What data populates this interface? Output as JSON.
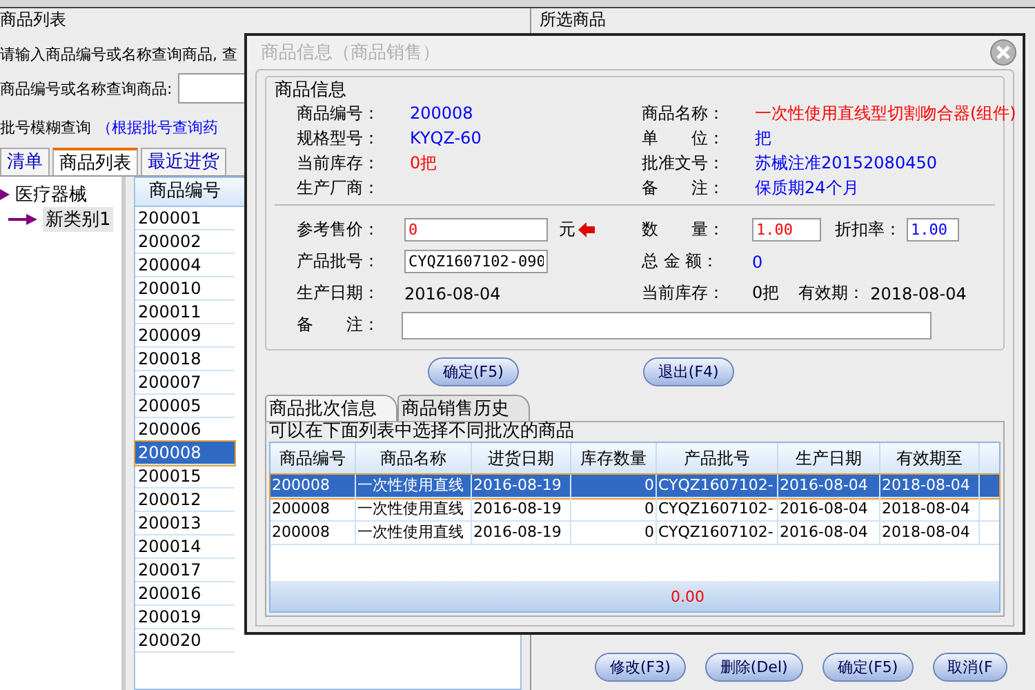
{
  "left_panel": {
    "group_title": "商品列表",
    "hint": "请输入商品编号或名称查询商品, 查",
    "search_label": "商品编号或名称查询商品:",
    "batch_label": "批号模糊查询",
    "batch_hint": "（根据批号查询药",
    "tabs": [
      {
        "label": "清单",
        "selected": false
      },
      {
        "label": "商品列表",
        "selected": true
      },
      {
        "label": "最近进货",
        "selected": false
      }
    ],
    "tree": [
      {
        "label": "医疗器械",
        "children": [
          {
            "label": "新类别1"
          }
        ]
      }
    ],
    "table": {
      "columns": [
        "商品编号"
      ],
      "rows": [
        {
          "code": "200001",
          "selected": false
        },
        {
          "code": "200002",
          "selected": false
        },
        {
          "code": "200004",
          "selected": false
        },
        {
          "code": "200010",
          "selected": false
        },
        {
          "code": "200011",
          "selected": false
        },
        {
          "code": "200009",
          "selected": false
        },
        {
          "code": "200018",
          "selected": false
        },
        {
          "code": "200007",
          "selected": false
        },
        {
          "code": "200005",
          "selected": false
        },
        {
          "code": "200006",
          "selected": false
        },
        {
          "code": "200008",
          "selected": true
        },
        {
          "code": "200015",
          "selected": false
        },
        {
          "code": "200012",
          "selected": false
        },
        {
          "code": "200013",
          "selected": false
        },
        {
          "code": "200014",
          "selected": false
        },
        {
          "code": "200017",
          "selected": false
        },
        {
          "code": "200016",
          "selected": false
        },
        {
          "code": "200019",
          "selected": false
        },
        {
          "code": "200020",
          "selected": false
        }
      ]
    }
  },
  "selected_panel": {
    "title": "所选商品",
    "buttons": [
      "修改(F3)",
      "删除(Del)",
      "确定(F5)",
      "取消(F"
    ]
  },
  "dialog": {
    "title": "商品信息（商品销售）",
    "info": {
      "title": "商品信息",
      "fields": [
        {
          "label": "商品编号：",
          "value": "200008",
          "color": "#0000ff"
        },
        {
          "label": "商品名称：",
          "value": "一次性使用直线型切割吻合器(组件)",
          "color": "#ff0000"
        },
        {
          "label": "规格型号：",
          "value": "KYQZ-60",
          "color": "#0000ff"
        },
        {
          "label": "单　　位：",
          "value": "把",
          "color": "#0000ff"
        },
        {
          "label": "当前库存：",
          "value": "0把",
          "color": "#ff0000"
        },
        {
          "label": "批准文号：",
          "value": "苏械注准20152080450",
          "color": "#0000ff"
        },
        {
          "label": "生产厂商："
        },
        {
          "label": "备　　注：",
          "value": "保质期24个月",
          "color": "#0000ff"
        }
      ]
    },
    "price": {
      "label": "参考售价：",
      "value": "0",
      "unit": "元"
    },
    "quantity": {
      "label": "数　　量：",
      "value": "1.00"
    },
    "discount": {
      "label": "折扣率：",
      "value": "1.00"
    },
    "batch": {
      "label": "产品批号：",
      "value": "CYQZ1607102-090"
    },
    "total": {
      "label": "总 金 额：",
      "value": "0"
    },
    "production_date": {
      "label": "生产日期：",
      "value": "2016-08-04"
    },
    "stock": {
      "label": "当前库存：",
      "value": "0把"
    },
    "expiry": {
      "label": "有效期：",
      "value": "2018-08-04"
    },
    "note": {
      "label": "备　　注："
    },
    "buttons": [
      "确定(F5)",
      "退出(F4)"
    ],
    "tabs": [
      {
        "label": "商品批次信息",
        "selected": true
      },
      {
        "label": "商品销售历史",
        "selected": false
      }
    ],
    "batch_group_title": "可以在下面列表中选择不同批次的商品",
    "batch_table": {
      "columns": [
        "商品编号",
        "商品名称",
        "进货日期",
        "库存数量",
        "产品批号",
        "生产日期",
        "有效期至"
      ],
      "rows": [
        {
          "cells": [
            "200008",
            "一次性使用直线",
            "2016-08-19",
            "0",
            "CYQZ1607102-",
            "2016-08-04",
            "2018-08-04"
          ],
          "selected": true
        },
        {
          "cells": [
            "200008",
            "一次性使用直线",
            "2016-08-19",
            "0",
            "CYQZ1607102-",
            "2016-08-04",
            "2018-08-04"
          ],
          "selected": false
        },
        {
          "cells": [
            "200008",
            "一次性使用直线",
            "2016-08-19",
            "0",
            "CYQZ1607102-",
            "2016-08-04",
            "2018-08-04"
          ],
          "selected": false
        }
      ],
      "total": "0.00"
    }
  }
}
